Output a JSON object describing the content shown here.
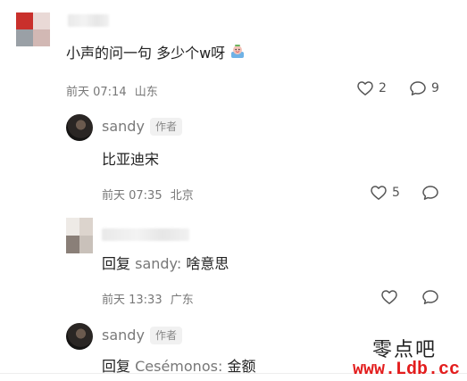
{
  "comments": [
    {
      "text": "小声的问一句 多少个w呀",
      "emoji": "smile-face",
      "time": "前天 07:14",
      "location": "山东",
      "likes": "2",
      "replies": "9"
    },
    {
      "username": "sandy",
      "tag": "作者",
      "text": "比亚迪宋",
      "time": "前天 07:35",
      "location": "北京",
      "likes": "5"
    },
    {
      "reply_prefix": "回复",
      "reply_target": "sandy:",
      "text": "啥意思",
      "time": "前天 13:33",
      "location": "广东"
    },
    {
      "username": "sandy",
      "tag": "作者",
      "reply_prefix": "回复",
      "reply_target": "Cesémonos:",
      "text": "金额"
    }
  ],
  "watermark": {
    "cn": "零点吧",
    "url": "www.Ldb.cc"
  },
  "colors": {
    "text": "#222222",
    "muted": "#777777",
    "tag_bg": "#f1f1f1",
    "watermark_red": "#e31d1d"
  }
}
